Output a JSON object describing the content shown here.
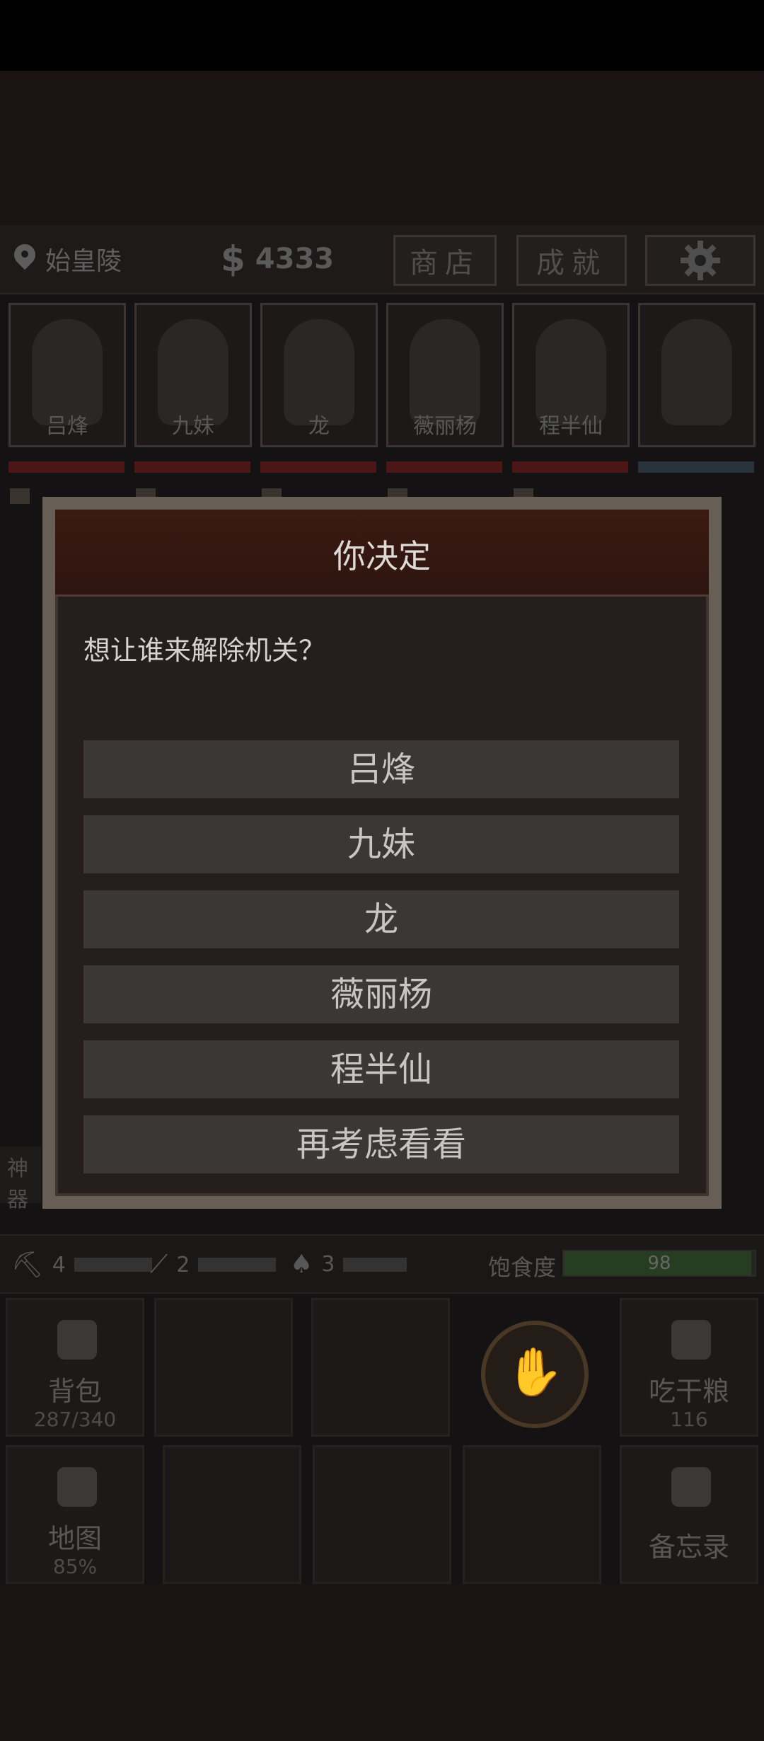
{
  "location": "始皇陵",
  "money": "4333",
  "top_buttons": {
    "shop": "商店",
    "achievements": "成就"
  },
  "characters": [
    "吕烽",
    "九妹",
    "龙",
    "薇丽杨",
    "程半仙"
  ],
  "left_side_label": "神器",
  "tools": [
    {
      "icon": "pickaxe-icon",
      "count": "4"
    },
    {
      "icon": "rope-hook-icon",
      "count": "2"
    },
    {
      "icon": "shovel-icon",
      "count": "3"
    }
  ],
  "hunger": {
    "label": "饱食度",
    "value": "98",
    "fraction": 0.98
  },
  "actions": {
    "backpack": {
      "label": "背包",
      "sub": "287/340"
    },
    "eat": {
      "label": "吃干粮",
      "sub": "116"
    },
    "map": {
      "label": "地图",
      "sub": "85%"
    },
    "memo": {
      "label": "备忘录"
    }
  },
  "dialog": {
    "title": "你决定",
    "question": "想让谁来解除机关？",
    "options": [
      "吕烽",
      "九妹",
      "龙",
      "薇丽杨",
      "程半仙",
      "再考虑看看"
    ]
  },
  "colors": {
    "dialog_header": "#3b1a12",
    "option_bg": "#3a3734",
    "hp_bar": "#4a1616",
    "hunger_bar": "#263d22"
  }
}
